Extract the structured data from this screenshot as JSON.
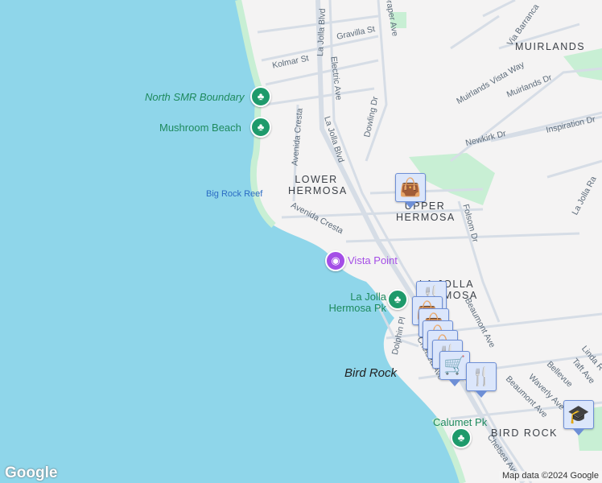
{
  "map": {
    "streets": [
      "Gravilla St",
      "Kolmar St",
      "La Jolla Blvd",
      "La Jolla Blvd",
      "Electric Ave",
      "Draper Ave",
      "Dowling Dr",
      "Avenida Cresta",
      "Avenida Cresta",
      "Via Barranca",
      "Muirlands Vista Way",
      "Muirlands Dr",
      "Newkirk Dr",
      "Inspiration Dr",
      "Folsom Dr",
      "La Jolla Ra",
      "Dolphin Pl",
      "Chelsea Ave",
      "Beaumont Ave",
      "Beaumont Ave",
      "Waverly Ave",
      "Bellevue",
      "Taft Ave",
      "Linda R",
      "Chelsea Ave"
    ],
    "neighborhoods": [
      "MUIRLANDS",
      "LOWER HERMOSA",
      "UPPER HERMOSA",
      "LA JOLLA HERMOSA",
      "BIRD ROCK"
    ],
    "places": {
      "north_smr": "North SMR Boundary",
      "mushroom": "Mushroom Beach",
      "big_rock": "Big Rock Reef",
      "vista": "Vista Point",
      "lj_hermosa_pk": "La Jolla Hermosa Pk",
      "bird_rock": "Bird Rock",
      "calumet": "Calumet Pk"
    },
    "attribution": "Map data ©2024 Google",
    "logo": "Google",
    "colors": {
      "water": "#8fd6ea",
      "land": "#f4f3f3",
      "park": "#c8efd4",
      "road": "#d6dde6",
      "poi": "#dbe6fb"
    }
  }
}
